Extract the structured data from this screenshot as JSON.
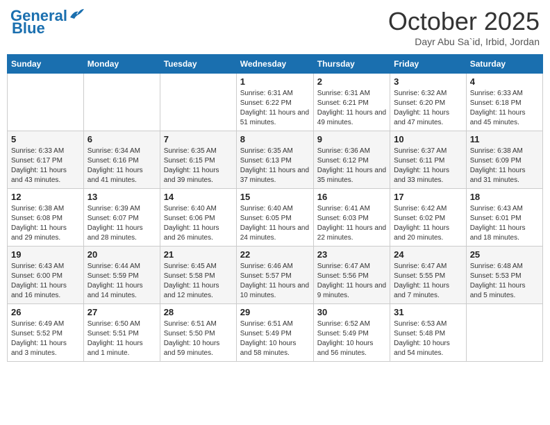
{
  "header": {
    "logo_line1": "General",
    "logo_line2": "Blue",
    "month_title": "October 2025",
    "subtitle": "Dayr Abu Sa`id, Irbid, Jordan"
  },
  "weekdays": [
    "Sunday",
    "Monday",
    "Tuesday",
    "Wednesday",
    "Thursday",
    "Friday",
    "Saturday"
  ],
  "rows": [
    [
      {
        "day": "",
        "info": ""
      },
      {
        "day": "",
        "info": ""
      },
      {
        "day": "",
        "info": ""
      },
      {
        "day": "1",
        "info": "Sunrise: 6:31 AM\nSunset: 6:22 PM\nDaylight: 11 hours and 51 minutes."
      },
      {
        "day": "2",
        "info": "Sunrise: 6:31 AM\nSunset: 6:21 PM\nDaylight: 11 hours and 49 minutes."
      },
      {
        "day": "3",
        "info": "Sunrise: 6:32 AM\nSunset: 6:20 PM\nDaylight: 11 hours and 47 minutes."
      },
      {
        "day": "4",
        "info": "Sunrise: 6:33 AM\nSunset: 6:18 PM\nDaylight: 11 hours and 45 minutes."
      }
    ],
    [
      {
        "day": "5",
        "info": "Sunrise: 6:33 AM\nSunset: 6:17 PM\nDaylight: 11 hours and 43 minutes."
      },
      {
        "day": "6",
        "info": "Sunrise: 6:34 AM\nSunset: 6:16 PM\nDaylight: 11 hours and 41 minutes."
      },
      {
        "day": "7",
        "info": "Sunrise: 6:35 AM\nSunset: 6:15 PM\nDaylight: 11 hours and 39 minutes."
      },
      {
        "day": "8",
        "info": "Sunrise: 6:35 AM\nSunset: 6:13 PM\nDaylight: 11 hours and 37 minutes."
      },
      {
        "day": "9",
        "info": "Sunrise: 6:36 AM\nSunset: 6:12 PM\nDaylight: 11 hours and 35 minutes."
      },
      {
        "day": "10",
        "info": "Sunrise: 6:37 AM\nSunset: 6:11 PM\nDaylight: 11 hours and 33 minutes."
      },
      {
        "day": "11",
        "info": "Sunrise: 6:38 AM\nSunset: 6:09 PM\nDaylight: 11 hours and 31 minutes."
      }
    ],
    [
      {
        "day": "12",
        "info": "Sunrise: 6:38 AM\nSunset: 6:08 PM\nDaylight: 11 hours and 29 minutes."
      },
      {
        "day": "13",
        "info": "Sunrise: 6:39 AM\nSunset: 6:07 PM\nDaylight: 11 hours and 28 minutes."
      },
      {
        "day": "14",
        "info": "Sunrise: 6:40 AM\nSunset: 6:06 PM\nDaylight: 11 hours and 26 minutes."
      },
      {
        "day": "15",
        "info": "Sunrise: 6:40 AM\nSunset: 6:05 PM\nDaylight: 11 hours and 24 minutes."
      },
      {
        "day": "16",
        "info": "Sunrise: 6:41 AM\nSunset: 6:03 PM\nDaylight: 11 hours and 22 minutes."
      },
      {
        "day": "17",
        "info": "Sunrise: 6:42 AM\nSunset: 6:02 PM\nDaylight: 11 hours and 20 minutes."
      },
      {
        "day": "18",
        "info": "Sunrise: 6:43 AM\nSunset: 6:01 PM\nDaylight: 11 hours and 18 minutes."
      }
    ],
    [
      {
        "day": "19",
        "info": "Sunrise: 6:43 AM\nSunset: 6:00 PM\nDaylight: 11 hours and 16 minutes."
      },
      {
        "day": "20",
        "info": "Sunrise: 6:44 AM\nSunset: 5:59 PM\nDaylight: 11 hours and 14 minutes."
      },
      {
        "day": "21",
        "info": "Sunrise: 6:45 AM\nSunset: 5:58 PM\nDaylight: 11 hours and 12 minutes."
      },
      {
        "day": "22",
        "info": "Sunrise: 6:46 AM\nSunset: 5:57 PM\nDaylight: 11 hours and 10 minutes."
      },
      {
        "day": "23",
        "info": "Sunrise: 6:47 AM\nSunset: 5:56 PM\nDaylight: 11 hours and 9 minutes."
      },
      {
        "day": "24",
        "info": "Sunrise: 6:47 AM\nSunset: 5:55 PM\nDaylight: 11 hours and 7 minutes."
      },
      {
        "day": "25",
        "info": "Sunrise: 6:48 AM\nSunset: 5:53 PM\nDaylight: 11 hours and 5 minutes."
      }
    ],
    [
      {
        "day": "26",
        "info": "Sunrise: 6:49 AM\nSunset: 5:52 PM\nDaylight: 11 hours and 3 minutes."
      },
      {
        "day": "27",
        "info": "Sunrise: 6:50 AM\nSunset: 5:51 PM\nDaylight: 11 hours and 1 minute."
      },
      {
        "day": "28",
        "info": "Sunrise: 6:51 AM\nSunset: 5:50 PM\nDaylight: 10 hours and 59 minutes."
      },
      {
        "day": "29",
        "info": "Sunrise: 6:51 AM\nSunset: 5:49 PM\nDaylight: 10 hours and 58 minutes."
      },
      {
        "day": "30",
        "info": "Sunrise: 6:52 AM\nSunset: 5:49 PM\nDaylight: 10 hours and 56 minutes."
      },
      {
        "day": "31",
        "info": "Sunrise: 6:53 AM\nSunset: 5:48 PM\nDaylight: 10 hours and 54 minutes."
      },
      {
        "day": "",
        "info": ""
      }
    ]
  ]
}
